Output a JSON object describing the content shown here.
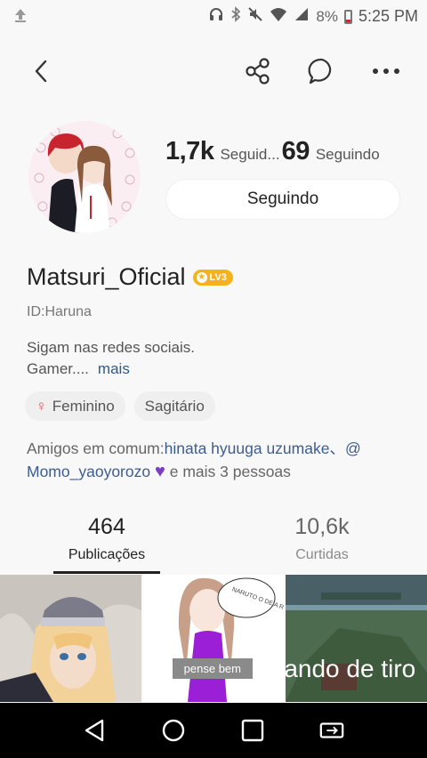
{
  "status_bar": {
    "battery": "8%",
    "time": "5:25 PM",
    "icons": [
      "upload-icon",
      "headphones-icon",
      "bluetooth-icon",
      "mute-icon",
      "wifi-icon",
      "signal-icon",
      "battery-icon"
    ]
  },
  "topbar": {
    "icons": [
      "back-icon",
      "share-icon",
      "chat-icon",
      "more-icon"
    ]
  },
  "profile": {
    "followers_count": "1,7k",
    "followers_label": "Seguid...",
    "following_count": "69",
    "following_label": "Seguindo",
    "follow_button": "Seguindo",
    "name": "Matsuri_Oficial",
    "level": "LV3",
    "id": "ID:Haruna",
    "bio_line1": "Sigam nas redes sociais.",
    "bio_line2": "Gamer....",
    "more_link": "mais"
  },
  "tags": {
    "gender": "Feminino",
    "zodiac": "Sagitário"
  },
  "mutual": {
    "prefix": "Amigos em comum:",
    "names": "hinata hyuuga uzumake、@ Momo_yaoyorozo",
    "suffix": "e mais 3 pessoas"
  },
  "tabs": [
    {
      "count": "464",
      "label": "Publicações"
    },
    {
      "count": "10,6k",
      "label": "Curtidas"
    }
  ],
  "grid": {
    "caption2": "pense bem",
    "sign_text": "NARUTO O DE A ROUPA",
    "caption3": "ando de tiro"
  },
  "colors": {
    "accent_blue": "#2e5a8a",
    "level_badge": "#f6b21c",
    "heart": "#7b3ec3",
    "background": "#f8f8f8"
  }
}
